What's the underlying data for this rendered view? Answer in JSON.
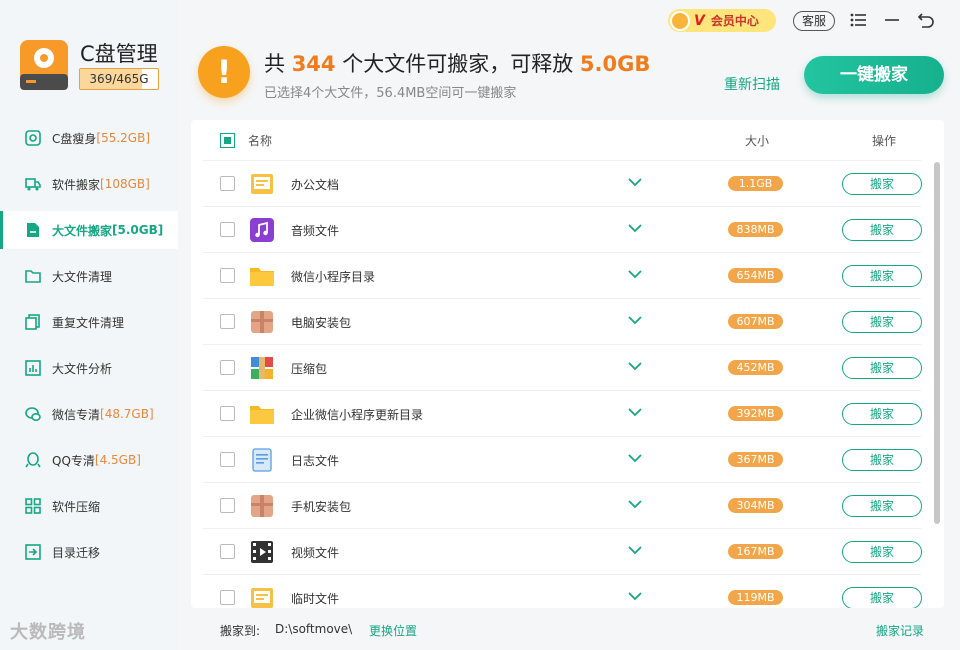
{
  "app": {
    "title": "C盘管理",
    "disk_usage": "369/465G",
    "disk_fill_fraction": 0.79
  },
  "sidebar": {
    "items": [
      {
        "label": "C盘瘦身",
        "extra": "[55.2GB]",
        "icon": "disk-slim-icon"
      },
      {
        "label": "软件搬家",
        "extra": "[108GB]",
        "icon": "truck-icon"
      },
      {
        "label": "大文件搬家",
        "extra": "[5.0GB]",
        "icon": "file-move-icon",
        "active": true
      },
      {
        "label": "大文件清理",
        "extra": "",
        "icon": "folder-icon"
      },
      {
        "label": "重复文件清理",
        "extra": "",
        "icon": "duplicate-icon"
      },
      {
        "label": "大文件分析",
        "extra": "",
        "icon": "chart-icon"
      },
      {
        "label": "微信专清",
        "extra": "[48.7GB]",
        "icon": "wechat-icon"
      },
      {
        "label": "QQ专清",
        "extra": "[4.5GB]",
        "icon": "qq-icon"
      },
      {
        "label": "软件压缩",
        "extra": "",
        "icon": "grid-icon"
      },
      {
        "label": "目录迁移",
        "extra": "",
        "icon": "migrate-icon"
      }
    ]
  },
  "topbar": {
    "vip_label": "会员中心",
    "vip_badge": "V",
    "service_label": "客服"
  },
  "header": {
    "prefix": "共 ",
    "count": "344",
    "mid": " 个大文件可搬家，可释放 ",
    "size": "5.0GB",
    "subtitle": "已选择4个大文件，56.4MB空间可一键搬家",
    "rescan": "重新扫描",
    "one_click": "一键搬家"
  },
  "table": {
    "col_name": "名称",
    "col_size": "大小",
    "col_action": "操作",
    "action_label": "搬家",
    "rows": [
      {
        "name": "办公文档",
        "size": "1.1GB",
        "icon": "document-folder-icon"
      },
      {
        "name": "音频文件",
        "size": "838MB",
        "icon": "music-icon"
      },
      {
        "name": "微信小程序目录",
        "size": "654MB",
        "icon": "folder-icon"
      },
      {
        "name": "电脑安装包",
        "size": "607MB",
        "icon": "package-icon"
      },
      {
        "name": "压缩包",
        "size": "452MB",
        "icon": "archive-icon"
      },
      {
        "name": "企业微信小程序更新目录",
        "size": "392MB",
        "icon": "folder-icon"
      },
      {
        "name": "日志文件",
        "size": "367MB",
        "icon": "log-icon"
      },
      {
        "name": "手机安装包",
        "size": "304MB",
        "icon": "package-icon"
      },
      {
        "name": "视频文件",
        "size": "167MB",
        "icon": "video-icon"
      },
      {
        "name": "临时文件",
        "size": "119MB",
        "icon": "document-folder-icon"
      }
    ]
  },
  "footer": {
    "label": "搬家到:",
    "path": "D:\\softmove\\",
    "change": "更换位置",
    "record": "搬家记录"
  },
  "watermark": "大数跨境",
  "colors": {
    "accent": "#16a785",
    "orange": "#f07c1e",
    "size_badge": "#f2a649"
  }
}
